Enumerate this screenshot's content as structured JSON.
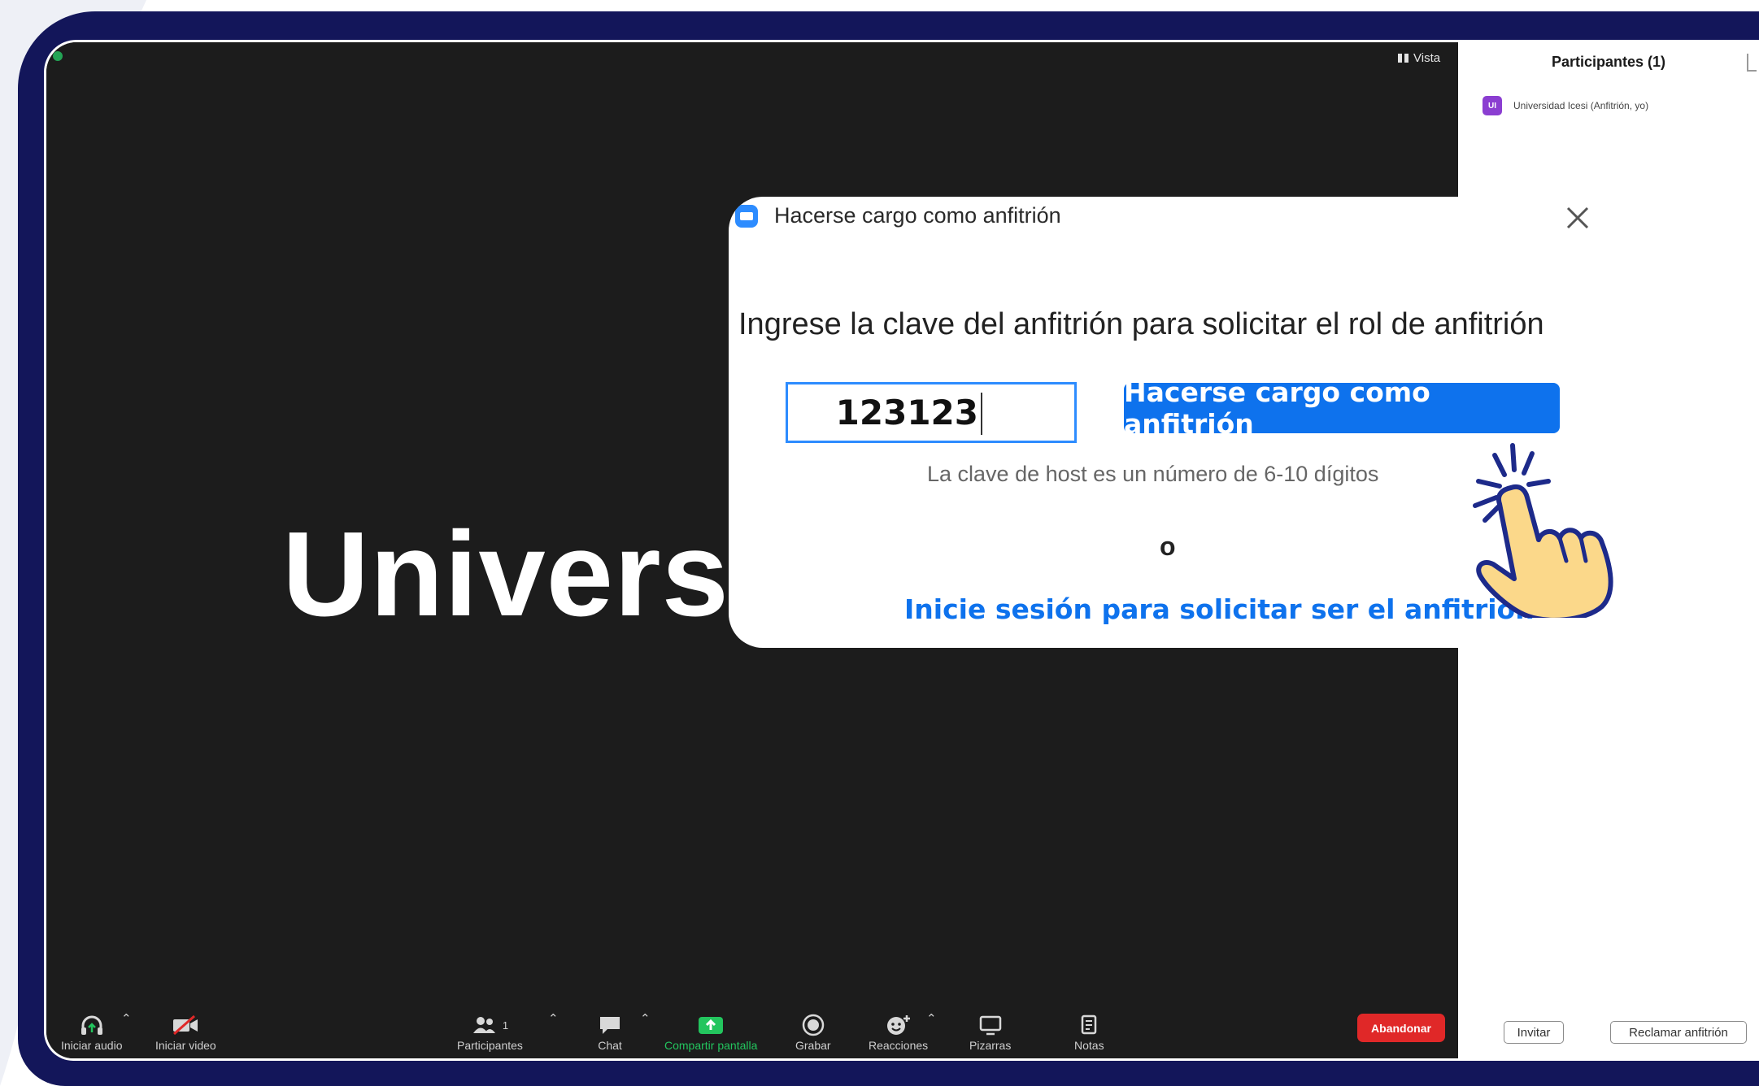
{
  "meeting": {
    "view_label": "Vista",
    "display_name": "Universid"
  },
  "toolbar": {
    "audio_label": "Iniciar audio",
    "video_label": "Iniciar video",
    "participants_label": "Participantes",
    "participants_count": "1",
    "chat_label": "Chat",
    "share_label": "Compartir pantalla",
    "record_label": "Grabar",
    "reactions_label": "Reacciones",
    "whiteboard_label": "Pizarras",
    "notes_label": "Notas",
    "leave_label": "Abandonar"
  },
  "panel": {
    "title": "Participantes (1)",
    "participant": {
      "initials": "UI",
      "name": "Universidad Icesi (Anfitrión, yo)"
    },
    "invite_label": "Invitar",
    "claim_host_label": "Reclamar anfitrión"
  },
  "dialog": {
    "title": "Hacerse cargo como anfitrión",
    "prompt": "Ingrese la clave del anfitrión para solicitar el rol de anfitrión",
    "host_key_value": "123123",
    "submit_label": "Hacerse cargo como anfitrión",
    "hint": "La clave de host es un número de 6-10 dígitos",
    "or": "o",
    "login_link": "Inicie sesión para solicitar ser el anfitrión"
  },
  "colors": {
    "frame": "#13165a",
    "accent_blue": "#0e72ed",
    "leave_red": "#e02828",
    "share_green": "#23c55e",
    "avatar_purple": "#8b3ed1"
  }
}
